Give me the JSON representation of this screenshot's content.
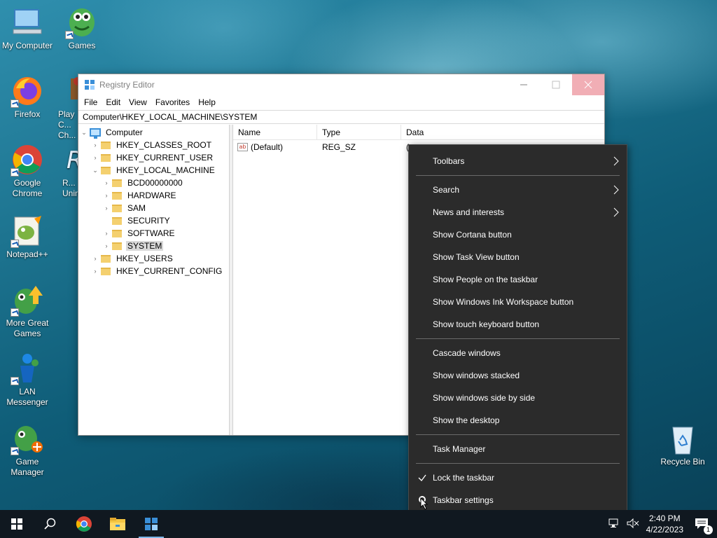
{
  "desktop": {
    "icons": [
      {
        "label": "My Computer",
        "icon": "computer-icon"
      },
      {
        "label": "Games",
        "icon": "games-icon"
      },
      {
        "label": "Firefox",
        "icon": "firefox-icon"
      },
      {
        "label": "Play C... Ch...",
        "icon": "chess-icon"
      },
      {
        "label": "Google Chrome",
        "icon": "chrome-icon"
      },
      {
        "label": "R... Unin...",
        "icon": "uninstaller-icon"
      },
      {
        "label": "Notepad++",
        "icon": "notepadpp-icon"
      },
      {
        "label": "More Great Games",
        "icon": "more-games-icon"
      },
      {
        "label": "LAN Messenger",
        "icon": "lan-messenger-icon"
      },
      {
        "label": "Game Manager",
        "icon": "game-manager-icon"
      },
      {
        "label": "Recycle Bin",
        "icon": "recycle-bin-icon"
      }
    ]
  },
  "regedit": {
    "title": "Registry Editor",
    "menu": [
      "File",
      "Edit",
      "View",
      "Favorites",
      "Help"
    ],
    "address": "Computer\\HKEY_LOCAL_MACHINE\\SYSTEM",
    "tree": {
      "root": "Computer",
      "hives": [
        "HKEY_CLASSES_ROOT",
        "HKEY_CURRENT_USER",
        "HKEY_LOCAL_MACHINE",
        "HKEY_USERS",
        "HKEY_CURRENT_CONFIG"
      ],
      "hklm_children": [
        "BCD00000000",
        "HARDWARE",
        "SAM",
        "SECURITY",
        "SOFTWARE",
        "SYSTEM"
      ],
      "selected": "SYSTEM"
    },
    "columns": [
      "Name",
      "Type",
      "Data"
    ],
    "rows": [
      {
        "name": "(Default)",
        "type": "REG_SZ",
        "data": "("
      }
    ]
  },
  "context_menu": {
    "items": [
      "Toolbars",
      "Search",
      "News and interests",
      "Show Cortana button",
      "Show Task View button",
      "Show People on the taskbar",
      "Show Windows Ink Workspace button",
      "Show touch keyboard button",
      "Cascade windows",
      "Show windows stacked",
      "Show windows side by side",
      "Show the desktop",
      "Task Manager",
      "Lock the taskbar",
      "Taskbar settings"
    ],
    "checked": "Lock the taskbar"
  },
  "taskbar": {
    "time": "2:40 PM",
    "date": "4/22/2023",
    "notification_count": "1",
    "accent": "#7cb7e8"
  }
}
